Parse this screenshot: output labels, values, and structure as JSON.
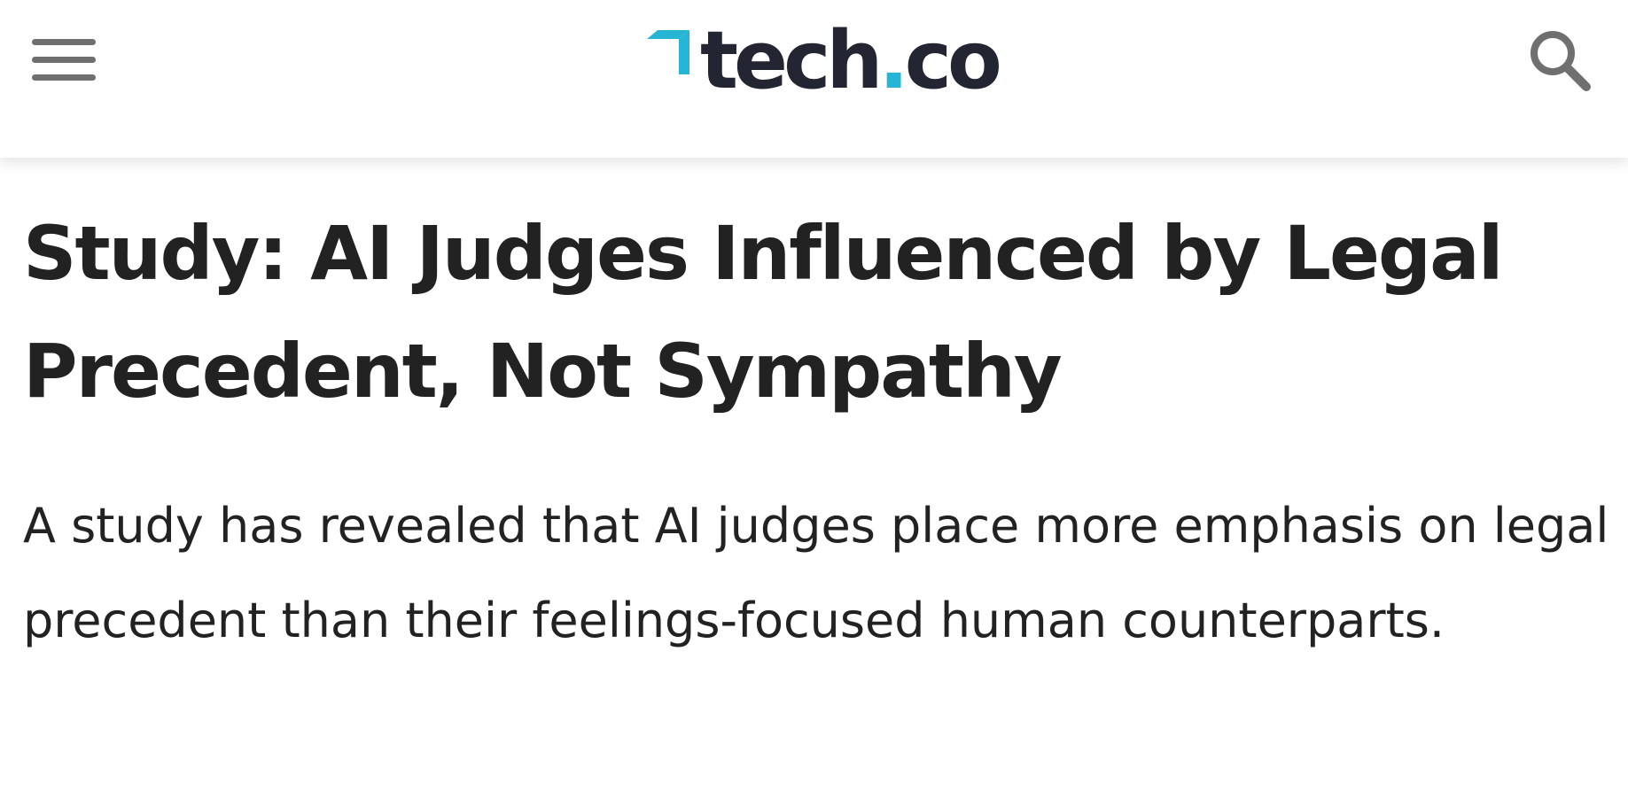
{
  "header": {
    "logo_text": "tech",
    "logo_dot": ".",
    "logo_suffix": "co",
    "brand_color": "#27b5d6",
    "menu_icon": "hamburger-menu-icon",
    "search_icon": "search-icon"
  },
  "article": {
    "headline": "Study: AI Judges Influenced by Legal Precedent, Not Sympathy",
    "summary": "A study has revealed that AI judges place more emphasis on legal precedent than their feelings-focused human counterparts."
  }
}
